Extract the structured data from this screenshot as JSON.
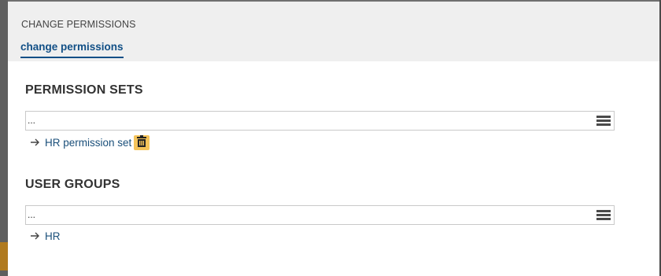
{
  "dialog": {
    "title": "CHANGE PERMISSIONS",
    "tab_label": "change permissions"
  },
  "permission_sets": {
    "heading": "PERMISSION SETS",
    "select_value": "...",
    "items": [
      {
        "label": "HR permission set",
        "icon": "arrow-right-icon",
        "action_icon": "trash-icon"
      }
    ]
  },
  "user_groups": {
    "heading": "USER GROUPS",
    "select_value": "...",
    "items": [
      {
        "label": "HR",
        "icon": "arrow-right-icon"
      }
    ]
  },
  "colors": {
    "accent": "#114f86",
    "link": "#1a4f7a",
    "delete_button": "#f4c35a",
    "header_bg": "#efefef"
  }
}
